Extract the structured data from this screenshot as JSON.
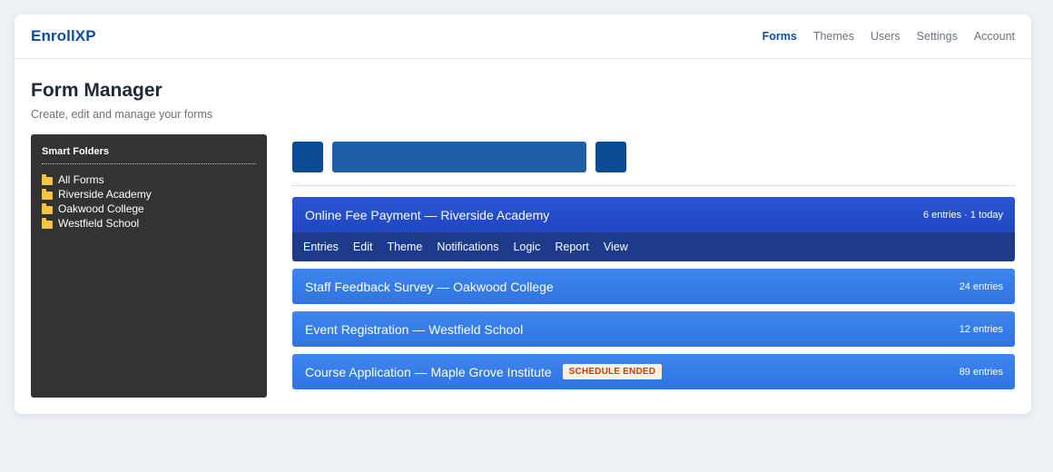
{
  "header": {
    "brand": "EnrollXP",
    "nav": [
      "Forms",
      "Themes",
      "Users",
      "Settings",
      "Account"
    ]
  },
  "page": {
    "title": "Form Manager",
    "subtitle": "Create, edit and manage your forms"
  },
  "sidebar": {
    "heading": "Smart Folders",
    "folders": [
      "All Forms",
      "Riverside Academy",
      "Oakwood College",
      "Westfield School"
    ]
  },
  "forms": [
    {
      "name": "Online Fee Payment — Riverside Academy",
      "count": "6 entries · 1 today"
    },
    {
      "name": "Staff Feedback Survey — Oakwood College",
      "count": "24 entries"
    },
    {
      "name": "Event Registration — Westfield School",
      "count": "12 entries"
    },
    {
      "name": "Course Application — Maple Grove Institute",
      "count": "89 entries",
      "badge": "SCHEDULE ENDED"
    }
  ],
  "form_actions": [
    "Entries",
    "Edit",
    "Theme",
    "Notifications",
    "Logic",
    "Report",
    "View"
  ],
  "colors": {
    "brand": "#0b4da2",
    "sidebar_bg": "#333333",
    "row_bg": "#3b82f6",
    "row_selected_bg": "#2449c7",
    "actions_bg": "#1e3a8a",
    "badge_text": "#c2410c"
  }
}
